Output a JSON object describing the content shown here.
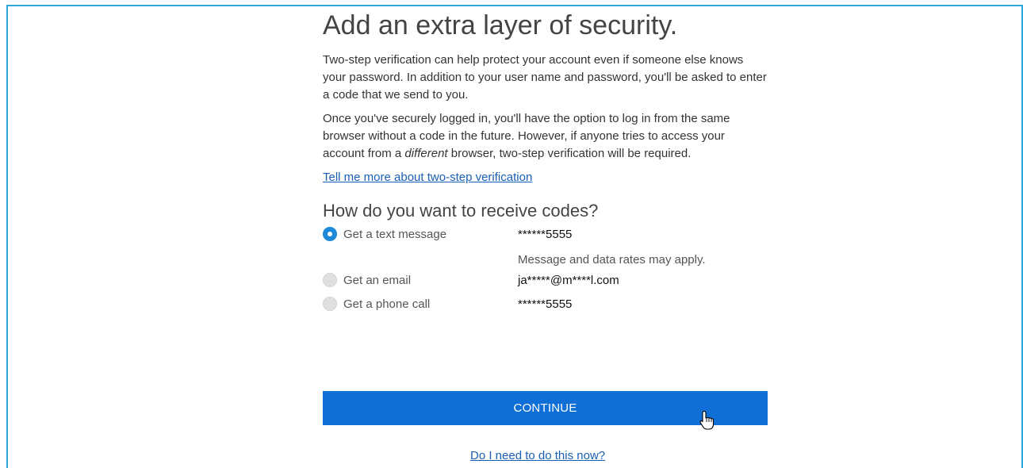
{
  "page": {
    "title": "Add an extra layer of security.",
    "intro": "Two-step verification can help protect your account even if someone else knows your password. In addition to your user name and password, you'll be asked to enter a code that we send to you.",
    "info_before": "Once you've securely logged in, you'll have the option to log in from the same browser without a code in the future. However, if anyone tries to access your account from a ",
    "info_emphasis": "different",
    "info_after": " browser, two-step verification will be required.",
    "learn_more_link": "Tell me more about two-step verification"
  },
  "codes": {
    "heading": "How do you want to receive codes?",
    "options": [
      {
        "label": "Get a text message",
        "value": "******5555",
        "selected": true,
        "note": "Message and data rates may apply."
      },
      {
        "label": "Get an email",
        "value": "ja*****@m****l.com",
        "selected": false
      },
      {
        "label": "Get a phone call",
        "value": "******5555",
        "selected": false
      }
    ]
  },
  "actions": {
    "continue_label": "CONTINUE",
    "later_link": "Do I need to do this now?"
  },
  "colors": {
    "accent": "#0f6fd6",
    "frame": "#2aa7dc",
    "link": "#1a5fb4"
  },
  "icons": {
    "cursor": "hand-pointer-icon"
  }
}
